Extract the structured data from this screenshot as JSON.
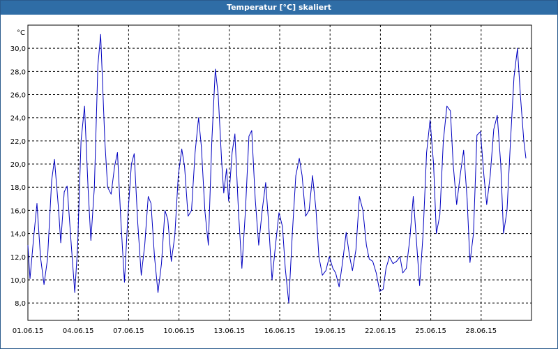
{
  "window": {
    "title": "Temperatur [°C] skaliert"
  },
  "chart_data": {
    "type": "line",
    "title": "Temperatur [°C] skaliert",
    "ylabel": "°C",
    "xlabel": "",
    "xlim": [
      "01.06.15",
      "30.06.15 24:00"
    ],
    "ylim": [
      6.5,
      32.0
    ],
    "grid": true,
    "x_ticks": [
      "01.06.15",
      "04.06.15",
      "07.06.15",
      "10.06.15",
      "13.06.15",
      "16.06.15",
      "19.06.15",
      "22.06.15",
      "25.06.15",
      "28.06.15"
    ],
    "y_ticks": [
      "8,0",
      "10,0",
      "12,0",
      "14,0",
      "16,0",
      "18,0",
      "20,0",
      "22,0",
      "24,0",
      "26,0",
      "28,0",
      "30,0"
    ],
    "y_tick_values": [
      8,
      10,
      12,
      14,
      16,
      18,
      20,
      22,
      24,
      26,
      28,
      30
    ],
    "series": [
      {
        "color": "#0000c0",
        "points": [
          [
            "01.06.15 00:00",
            13.0
          ],
          [
            "01.06.15 03:00",
            10.1
          ],
          [
            "01.06.15 08:00",
            13.5
          ],
          [
            "01.06.15 13:00",
            16.6
          ],
          [
            "01.06.15 18:00",
            12.0
          ],
          [
            "01.06.15 23:00",
            9.6
          ],
          [
            "02.06.15 04:00",
            11.8
          ],
          [
            "02.06.15 10:00",
            18.6
          ],
          [
            "02.06.15 14:00",
            20.4
          ],
          [
            "02.06.15 20:00",
            16.0
          ],
          [
            "02.06.15 23:00",
            13.2
          ],
          [
            "03.06.15 04:00",
            17.6
          ],
          [
            "03.06.15 08:00",
            18.1
          ],
          [
            "03.06.15 14:00",
            13.0
          ],
          [
            "03.06.15 19:00",
            8.9
          ],
          [
            "03.06.15 23:00",
            12.8
          ],
          [
            "04.06.15 04:00",
            22.0
          ],
          [
            "04.06.15 09:00",
            25.0
          ],
          [
            "04.06.15 14:00",
            18.0
          ],
          [
            "04.06.15 18:00",
            13.4
          ],
          [
            "04.06.15 23:00",
            18.0
          ],
          [
            "05.06.15 04:00",
            28.5
          ],
          [
            "05.06.15 08:00",
            31.2
          ],
          [
            "05.06.15 14:00",
            22.0
          ],
          [
            "05.06.15 18:00",
            18.0
          ],
          [
            "05.06.15 23:00",
            17.4
          ],
          [
            "06.06.15 04:00",
            19.8
          ],
          [
            "06.06.15 08:00",
            21.0
          ],
          [
            "06.06.15 13:00",
            15.0
          ],
          [
            "06.06.15 18:00",
            9.8
          ],
          [
            "06.06.15 23:00",
            15.6
          ],
          [
            "07.06.15 04:00",
            20.0
          ],
          [
            "07.06.15 08:00",
            20.9
          ],
          [
            "07.06.15 13:00",
            15.0
          ],
          [
            "07.06.15 18:00",
            10.4
          ],
          [
            "07.06.15 23:00",
            13.0
          ],
          [
            "08.06.15 04:00",
            17.2
          ],
          [
            "08.06.15 08:00",
            16.6
          ],
          [
            "08.06.15 13:00",
            12.0
          ],
          [
            "08.06.15 18:00",
            8.9
          ],
          [
            "08.06.15 23:00",
            11.4
          ],
          [
            "09.06.15 04:00",
            16.0
          ],
          [
            "09.06.15 08:00",
            15.2
          ],
          [
            "09.06.15 13:00",
            11.6
          ],
          [
            "09.06.15 18:00",
            13.8
          ],
          [
            "09.06.15 23:00",
            19.0
          ],
          [
            "10.06.15 04:00",
            21.3
          ],
          [
            "10.06.15 08:00",
            19.8
          ],
          [
            "10.06.15 13:00",
            15.5
          ],
          [
            "10.06.15 18:00",
            16.0
          ],
          [
            "10.06.15 23:00",
            21.0
          ],
          [
            "11.06.15 04:00",
            24.0
          ],
          [
            "11.06.15 08:00",
            21.5
          ],
          [
            "11.06.15 13:00",
            16.0
          ],
          [
            "11.06.15 18:00",
            13.0
          ],
          [
            "11.06.15 23:00",
            22.0
          ],
          [
            "12.06.15 04:00",
            28.2
          ],
          [
            "12.06.15 08:00",
            26.0
          ],
          [
            "12.06.15 13:00",
            20.2
          ],
          [
            "12.06.15 16:00",
            17.5
          ],
          [
            "12.06.15 20:00",
            19.6
          ],
          [
            "12.06.15 23:00",
            16.8
          ],
          [
            "13.06.15 04:00",
            21.0
          ],
          [
            "13.06.15 08:00",
            22.6
          ],
          [
            "13.06.15 13:00",
            16.0
          ],
          [
            "13.06.15 18:00",
            11.0
          ],
          [
            "13.06.15 23:00",
            16.0
          ],
          [
            "14.06.15 04:00",
            22.4
          ],
          [
            "14.06.15 08:00",
            22.9
          ],
          [
            "14.06.15 13:00",
            17.0
          ],
          [
            "14.06.15 18:00",
            13.0
          ],
          [
            "14.06.15 23:00",
            16.0
          ],
          [
            "15.06.15 04:00",
            18.4
          ],
          [
            "15.06.15 08:00",
            15.0
          ],
          [
            "15.06.15 13:00",
            10.0
          ],
          [
            "15.06.15 18:00",
            13.0
          ],
          [
            "15.06.15 23:00",
            15.8
          ],
          [
            "16.06.15 04:00",
            14.6
          ],
          [
            "16.06.15 08:00",
            11.0
          ],
          [
            "16.06.15 13:00",
            8.0
          ],
          [
            "16.06.15 18:00",
            14.0
          ],
          [
            "16.06.15 23:00",
            19.0
          ],
          [
            "17.06.15 04:00",
            20.5
          ],
          [
            "17.06.15 08:00",
            19.0
          ],
          [
            "17.06.15 13:00",
            15.5
          ],
          [
            "17.06.15 18:00",
            16.0
          ],
          [
            "17.06.15 23:00",
            19.0
          ],
          [
            "18.06.15 04:00",
            16.0
          ],
          [
            "18.06.15 08:00",
            12.0
          ],
          [
            "18.06.15 13:00",
            10.4
          ],
          [
            "18.06.15 18:00",
            10.8
          ],
          [
            "18.06.15 23:00",
            12.0
          ],
          [
            "19.06.15 04:00",
            11.0
          ],
          [
            "19.06.15 08:00",
            10.6
          ],
          [
            "19.06.15 13:00",
            9.4
          ],
          [
            "19.06.15 18:00",
            11.6
          ],
          [
            "19.06.15 23:00",
            14.1
          ],
          [
            "20.06.15 04:00",
            12.0
          ],
          [
            "20.06.15 08:00",
            10.8
          ],
          [
            "20.06.15 13:00",
            12.6
          ],
          [
            "20.06.15 18:00",
            17.2
          ],
          [
            "20.06.15 23:00",
            16.0
          ],
          [
            "21.06.15 04:00",
            13.0
          ],
          [
            "21.06.15 08:00",
            11.8
          ],
          [
            "21.06.15 13:00",
            11.6
          ],
          [
            "21.06.15 18:00",
            10.6
          ],
          [
            "21.06.15 23:00",
            9.0
          ],
          [
            "22.06.15 04:00",
            9.2
          ],
          [
            "22.06.15 08:00",
            11.0
          ],
          [
            "22.06.15 13:00",
            12.0
          ],
          [
            "22.06.15 18:00",
            11.4
          ],
          [
            "22.06.15 23:00",
            11.6
          ],
          [
            "23.06.15 04:00",
            12.0
          ],
          [
            "23.06.15 08:00",
            10.6
          ],
          [
            "23.06.15 13:00",
            11.0
          ],
          [
            "23.06.15 18:00",
            13.5
          ],
          [
            "23.06.15 23:00",
            17.2
          ],
          [
            "24.06.15 04:00",
            13.0
          ],
          [
            "24.06.15 08:00",
            9.5
          ],
          [
            "24.06.15 13:00",
            14.0
          ],
          [
            "24.06.15 18:00",
            21.0
          ],
          [
            "24.06.15 23:00",
            23.8
          ],
          [
            "25.06.15 04:00",
            20.0
          ],
          [
            "25.06.15 08:00",
            14.0
          ],
          [
            "25.06.15 13:00",
            15.6
          ],
          [
            "25.06.15 18:00",
            22.0
          ],
          [
            "25.06.15 23:00",
            25.0
          ],
          [
            "26.06.15 04:00",
            24.6
          ],
          [
            "26.06.15 08:00",
            20.0
          ],
          [
            "26.06.15 13:00",
            16.5
          ],
          [
            "26.06.15 18:00",
            19.0
          ],
          [
            "26.06.15 23:00",
            21.2
          ],
          [
            "27.06.15 04:00",
            17.0
          ],
          [
            "27.06.15 08:00",
            11.5
          ],
          [
            "27.06.15 13:00",
            14.0
          ],
          [
            "27.06.15 18:00",
            22.5
          ],
          [
            "27.06.15 23:00",
            22.8
          ],
          [
            "28.06.15 04:00",
            19.0
          ],
          [
            "28.06.15 08:00",
            16.5
          ],
          [
            "28.06.15 13:00",
            19.0
          ],
          [
            "28.06.15 18:00",
            23.0
          ],
          [
            "28.06.15 23:00",
            24.2
          ],
          [
            "29.06.15 04:00",
            20.0
          ],
          [
            "29.06.15 08:00",
            14.0
          ],
          [
            "29.06.15 13:00",
            16.0
          ],
          [
            "29.06.15 18:00",
            22.0
          ],
          [
            "29.06.15 23:00",
            27.5
          ],
          [
            "30.06.15 04:00",
            30.0
          ],
          [
            "30.06.15 08:00",
            26.0
          ],
          [
            "30.06.15 13:00",
            22.0
          ],
          [
            "30.06.15 16:00",
            20.5
          ]
        ]
      }
    ]
  }
}
